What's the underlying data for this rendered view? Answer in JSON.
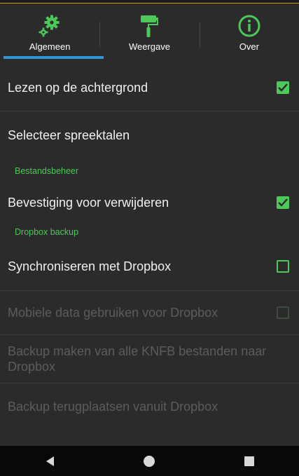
{
  "tabs": [
    {
      "label": "Algemeen",
      "icon": "gears-icon",
      "selected": true
    },
    {
      "label": "Weergave",
      "icon": "paint-roller-icon",
      "selected": false
    },
    {
      "label": "Over",
      "icon": "info-icon",
      "selected": false
    }
  ],
  "settings": {
    "read_background": {
      "title": "Lezen op de achtergrond",
      "checked": true
    },
    "select_languages": {
      "title": "Selecteer spreektalen"
    },
    "section_file": "Bestandsbeheer",
    "confirm_delete": {
      "title": "Bevestiging voor verwijderen",
      "checked": true
    },
    "section_dropbox": "Dropbox backup",
    "sync_dropbox": {
      "title": "Synchroniseren met Dropbox",
      "checked": false
    },
    "mobile_data": {
      "title": "Mobiele data gebruiken voor Dropbox",
      "checked": false,
      "enabled": false
    },
    "backup_all": {
      "title": "Backup maken van alle KNFB bestanden naar Dropbox",
      "enabled": false
    },
    "restore_backup": {
      "title": "Backup terugplaatsen vanuit Dropbox",
      "enabled": false
    }
  },
  "colors": {
    "accent": "#4dc85a",
    "tab_indicator": "#2f97d8",
    "background": "#2b2b2b"
  },
  "navbar": [
    "back-icon",
    "home-icon",
    "recents-icon"
  ]
}
